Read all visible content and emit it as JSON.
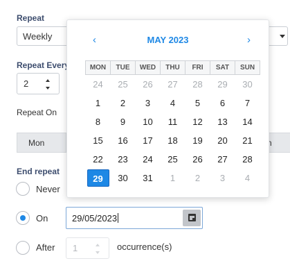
{
  "repeat": {
    "label": "Repeat",
    "value": "Weekly"
  },
  "repeat_every": {
    "label": "Repeat Every",
    "value": "2"
  },
  "repeat_on": {
    "label": "Repeat On",
    "days": [
      {
        "label": "Mon"
      },
      {
        "label": "n"
      }
    ]
  },
  "end_repeat": {
    "label": "End repeat",
    "options": {
      "never": {
        "label": "Never",
        "checked": false
      },
      "on": {
        "label": "On",
        "checked": true,
        "date_value": "29/05/2023"
      },
      "after": {
        "label": "After",
        "checked": false,
        "count_value": "1",
        "suffix": "occurrence(s)"
      }
    }
  },
  "datepicker": {
    "month_title": "MAY 2023",
    "prev_icon": "chevron-left-icon",
    "next_icon": "chevron-right-icon",
    "calendar_icon": "calendar-icon",
    "weekdays": [
      "MON",
      "TUE",
      "WED",
      "THU",
      "FRI",
      "SAT",
      "SUN"
    ],
    "weeks": [
      [
        {
          "d": "24",
          "m": true
        },
        {
          "d": "25",
          "m": true
        },
        {
          "d": "26",
          "m": true
        },
        {
          "d": "27",
          "m": true
        },
        {
          "d": "28",
          "m": true
        },
        {
          "d": "29",
          "m": true
        },
        {
          "d": "30",
          "m": true
        }
      ],
      [
        {
          "d": "1"
        },
        {
          "d": "2"
        },
        {
          "d": "3"
        },
        {
          "d": "4"
        },
        {
          "d": "5"
        },
        {
          "d": "6"
        },
        {
          "d": "7"
        }
      ],
      [
        {
          "d": "8"
        },
        {
          "d": "9"
        },
        {
          "d": "10"
        },
        {
          "d": "11"
        },
        {
          "d": "12"
        },
        {
          "d": "13"
        },
        {
          "d": "14"
        }
      ],
      [
        {
          "d": "15"
        },
        {
          "d": "16"
        },
        {
          "d": "17"
        },
        {
          "d": "18"
        },
        {
          "d": "19"
        },
        {
          "d": "20"
        },
        {
          "d": "21"
        }
      ],
      [
        {
          "d": "22"
        },
        {
          "d": "23"
        },
        {
          "d": "24"
        },
        {
          "d": "25"
        },
        {
          "d": "26"
        },
        {
          "d": "27"
        },
        {
          "d": "28"
        }
      ],
      [
        {
          "d": "29",
          "sel": true
        },
        {
          "d": "30"
        },
        {
          "d": "31"
        },
        {
          "d": "1",
          "m": true
        },
        {
          "d": "2",
          "m": true
        },
        {
          "d": "3",
          "m": true
        },
        {
          "d": "4",
          "m": true
        }
      ]
    ],
    "accent_color": "#1e88e5"
  }
}
